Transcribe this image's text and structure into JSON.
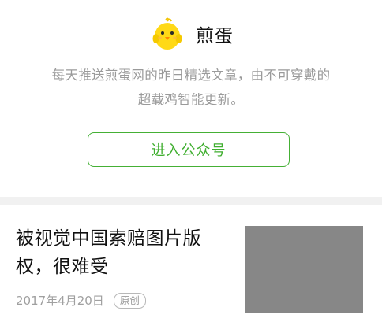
{
  "account": {
    "name": "煎蛋",
    "description_line1": "每天推送煎蛋网的昨日精选文章，由不可穿戴的",
    "description_line2": "超载鸡智能更新。",
    "follow_button_label": "进入公众号",
    "avatar_icon": "yellow-chick-icon"
  },
  "article": {
    "title_line1": "被视觉中国索赔图片版",
    "title_line2": "权，很难受",
    "date": "2017年4月20日",
    "badge": "原创"
  },
  "colors": {
    "accent_green": "#45b035",
    "muted_text": "#9a9a9a",
    "divider": "#f1f1f1",
    "thumbnail_gray": "#878787"
  }
}
